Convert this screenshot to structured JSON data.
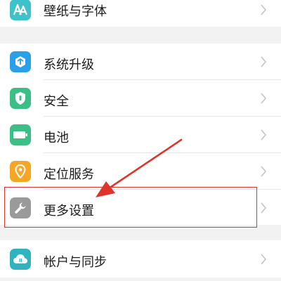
{
  "settings": {
    "items": [
      {
        "label": "壁纸与字体",
        "icon": "font-icon",
        "color": "#3cc2c8"
      },
      {
        "label": "系统升级",
        "icon": "system-update-icon",
        "color": "#2aa0e8"
      },
      {
        "label": "安全",
        "icon": "shield-icon",
        "color": "#3cbf86"
      },
      {
        "label": "电池",
        "icon": "battery-icon",
        "color": "#3cbf86"
      },
      {
        "label": "定位服务",
        "icon": "location-icon",
        "color": "#f6a623"
      },
      {
        "label": "更多设置",
        "icon": "wrench-icon",
        "color": "#9a9a9a"
      },
      {
        "label": "帐户与同步",
        "icon": "cloud-sync-icon",
        "color": "#2fb3c0"
      }
    ]
  },
  "annotation": {
    "color": "#e0342b"
  }
}
